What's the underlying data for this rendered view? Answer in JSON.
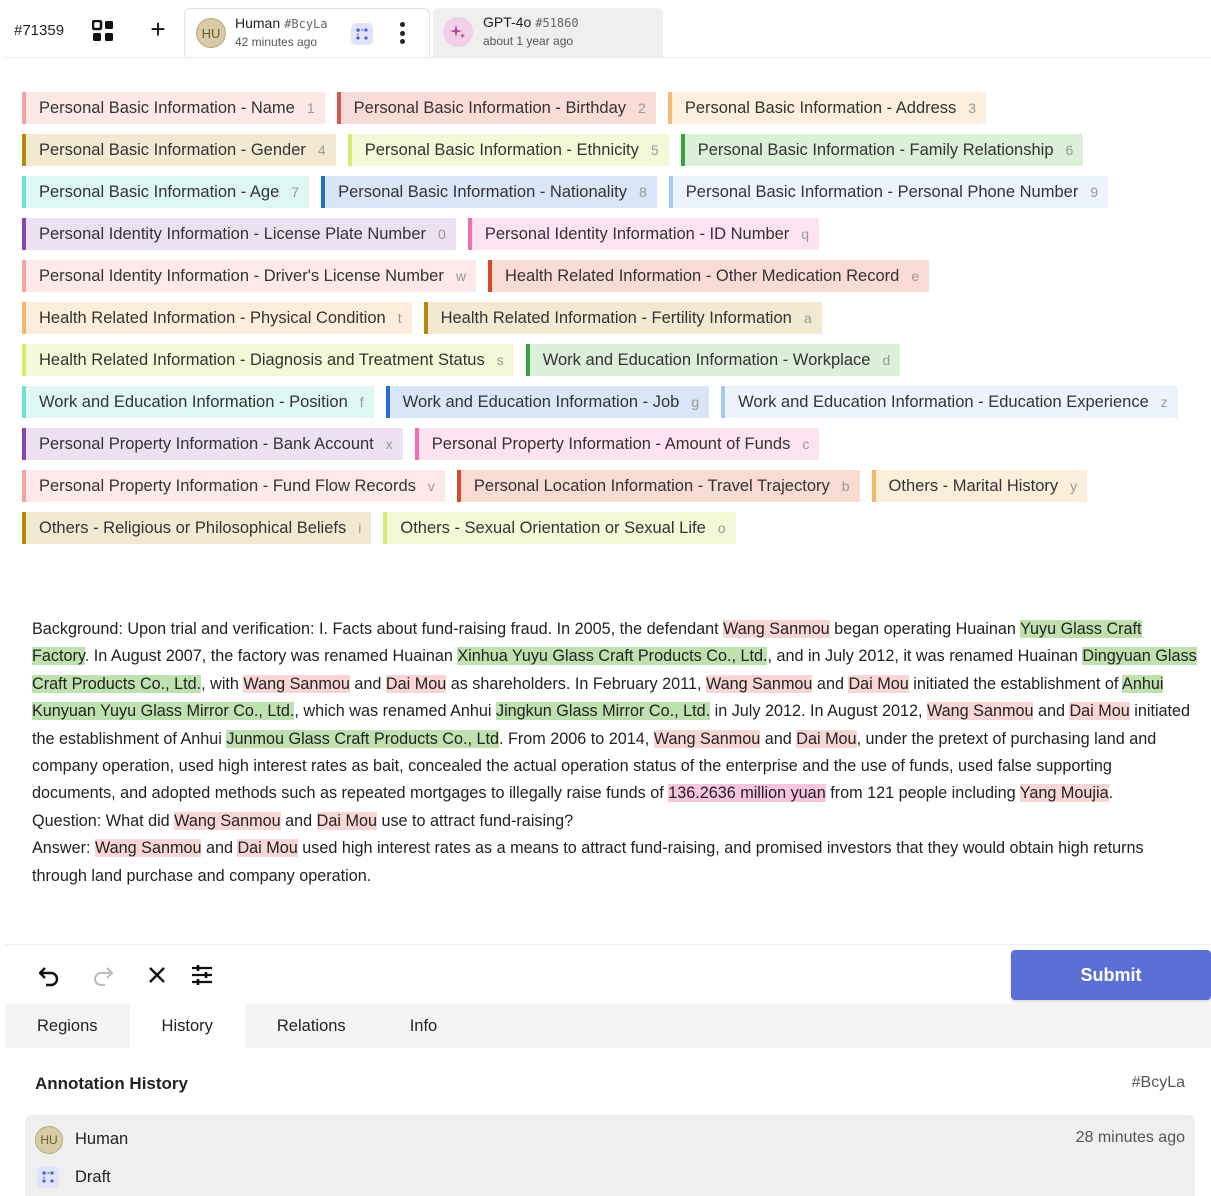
{
  "topbar": {
    "task_id": "#71359",
    "annotation_tab": {
      "user": "Human",
      "avatar": "HU",
      "id": "#BcyLa",
      "time": "42 minutes ago"
    },
    "prediction_tab": {
      "user": "GPT-4o",
      "id": "#51860",
      "time": "about 1 year ago"
    }
  },
  "labels": [
    {
      "text": "Personal Basic Information - Name",
      "hotkey": "1",
      "color": "#f3a3a3",
      "bg": "#fde8e8"
    },
    {
      "text": "Personal Basic Information - Birthday",
      "hotkey": "2",
      "color": "#d9534f",
      "bg": "#f9dcd8"
    },
    {
      "text": "Personal Basic Information - Address",
      "hotkey": "3",
      "color": "#f5b97a",
      "bg": "#fdeedd"
    },
    {
      "text": "Personal Basic Information - Gender",
      "hotkey": "4",
      "color": "#b8860b",
      "bg": "#f3e9d2"
    },
    {
      "text": "Personal Basic Information - Ethnicity",
      "hotkey": "5",
      "color": "#d4ed6b",
      "bg": "#f3f9d8"
    },
    {
      "text": "Personal Basic Information - Family Relationship",
      "hotkey": "6",
      "color": "#3aa33a",
      "bg": "#dcefd8"
    },
    {
      "text": "Personal Basic Information - Age",
      "hotkey": "7",
      "color": "#6fe0d4",
      "bg": "#dff7f3"
    },
    {
      "text": "Personal Basic Information - Nationality",
      "hotkey": "8",
      "color": "#1f6fd1",
      "bg": "#d9e6f7"
    },
    {
      "text": "Personal Basic Information - Personal Phone Number",
      "hotkey": "9",
      "color": "#a8c8f5",
      "bg": "#edf3fc"
    },
    {
      "text": "Personal Identity Information - License Plate Number",
      "hotkey": "0",
      "color": "#8e44ad",
      "bg": "#ece1f2"
    },
    {
      "text": "Personal Identity Information - ID Number",
      "hotkey": "q",
      "color": "#f06fb0",
      "bg": "#fde2ef"
    },
    {
      "text": "Personal Identity Information - Driver's License Number",
      "hotkey": "w",
      "color": "#f5a3a3",
      "bg": "#fde9e9"
    },
    {
      "text": "Health Related Information - Other Medication Record",
      "hotkey": "e",
      "color": "#d44a2a",
      "bg": "#f8dbd3"
    },
    {
      "text": "Health Related Information - Physical Condition",
      "hotkey": "t",
      "color": "#f5b66b",
      "bg": "#fdeedc"
    },
    {
      "text": "Health Related Information - Fertility Information",
      "hotkey": "a",
      "color": "#b8860b",
      "bg": "#f3e9d2"
    },
    {
      "text": "Health Related Information - Diagnosis and Treatment Status",
      "hotkey": "s",
      "color": "#d4ed6b",
      "bg": "#f3f9d8"
    },
    {
      "text": "Work and Education Information - Workplace",
      "hotkey": "d",
      "color": "#3aa33a",
      "bg": "#dcefd8"
    },
    {
      "text": "Work and Education Information - Position",
      "hotkey": "f",
      "color": "#6fe0d4",
      "bg": "#dff7f3"
    },
    {
      "text": "Work and Education Information - Job",
      "hotkey": "g",
      "color": "#1f6fd1",
      "bg": "#d9e6f7"
    },
    {
      "text": "Work and Education Information - Education Experience",
      "hotkey": "z",
      "color": "#a8c8f5",
      "bg": "#edf3fc"
    },
    {
      "text": "Personal Property Information - Bank Account",
      "hotkey": "x",
      "color": "#8e44ad",
      "bg": "#ece1f2"
    },
    {
      "text": "Personal Property Information - Amount of Funds",
      "hotkey": "c",
      "color": "#f06fb0",
      "bg": "#fde2ef"
    },
    {
      "text": "Personal Property Information - Fund Flow Records",
      "hotkey": "v",
      "color": "#f5a3a3",
      "bg": "#fde9e9"
    },
    {
      "text": "Personal Location Information - Travel Trajectory",
      "hotkey": "b",
      "color": "#d44a2a",
      "bg": "#f8dbd3"
    },
    {
      "text": "Others - Marital History",
      "hotkey": "y",
      "color": "#f5b66b",
      "bg": "#fdeedc"
    },
    {
      "text": "Others - Religious or Philosophical Beliefs",
      "hotkey": "i",
      "color": "#b8860b",
      "bg": "#f3e9d2"
    },
    {
      "text": "Others - Sexual Orientation or Sexual Life",
      "hotkey": "o",
      "color": "#d4ed6b",
      "bg": "#f3f9d8"
    }
  ],
  "document": {
    "paragraphs": [
      [
        {
          "t": "Background: Upon trial and verification: I. Facts about fund-raising fraud. In 2005, the defendant "
        },
        {
          "t": "Wang Sanmou",
          "h": "name"
        },
        {
          "t": " began operating Huainan "
        },
        {
          "t": "Yuyu Glass Craft Factory",
          "h": "org"
        },
        {
          "t": ". In August 2007, the factory was renamed Huainan "
        },
        {
          "t": "Xinhua Yuyu Glass Craft Products Co., Ltd.",
          "h": "org"
        },
        {
          "t": ", and in July 2012, it was renamed Huainan "
        },
        {
          "t": "Dingyuan Glass Craft Products Co., Ltd.",
          "h": "org"
        },
        {
          "t": ", with "
        },
        {
          "t": "Wang Sanmou",
          "h": "name"
        },
        {
          "t": " and "
        },
        {
          "t": "Dai Mou",
          "h": "name"
        },
        {
          "t": " as shareholders. In February 2011, "
        },
        {
          "t": "Wang Sanmou",
          "h": "name"
        },
        {
          "t": " and "
        },
        {
          "t": "Dai Mou",
          "h": "name"
        },
        {
          "t": " initiated the establishment of "
        },
        {
          "t": "Anhui Kunyuan Yuyu Glass Mirror Co., Ltd.",
          "h": "org"
        },
        {
          "t": ", which was renamed Anhui "
        },
        {
          "t": "Jingkun Glass Mirror Co., Ltd.",
          "h": "org"
        },
        {
          "t": " in July 2012. In August 2012, "
        },
        {
          "t": "Wang Sanmou",
          "h": "name"
        },
        {
          "t": " and "
        },
        {
          "t": "Dai Mou",
          "h": "name"
        },
        {
          "t": " initiated the establishment of Anhui "
        },
        {
          "t": "Junmou Glass Craft Products Co., Ltd",
          "h": "org"
        },
        {
          "t": ". From 2006 to 2014, "
        },
        {
          "t": "Wang Sanmou",
          "h": "name"
        },
        {
          "t": " and "
        },
        {
          "t": "Dai Mou",
          "h": "name"
        },
        {
          "t": ", under the pretext of purchasing land and company operation, used high interest rates as bait, concealed the actual operation status of the enterprise and the use of funds, used false supporting documents, and adopted methods such as repeated mortgages to illegally raise funds of "
        },
        {
          "t": "136.2636 million yuan",
          "h": "money"
        },
        {
          "t": " from 121 people including "
        },
        {
          "t": "Yang Moujia",
          "h": "name"
        },
        {
          "t": "."
        }
      ],
      [
        {
          "t": "Question: What did "
        },
        {
          "t": "Wang Sanmou",
          "h": "name"
        },
        {
          "t": " and "
        },
        {
          "t": "Dai Mou",
          "h": "name"
        },
        {
          "t": " use to attract fund-raising?"
        }
      ],
      [
        {
          "t": "Answer: "
        },
        {
          "t": "Wang Sanmou",
          "h": "name"
        },
        {
          "t": " and "
        },
        {
          "t": "Dai Mou",
          "h": "name"
        },
        {
          "t": " used high interest rates as a means to attract fund-raising, and promised investors that they would obtain high returns through land purchase and company operation."
        }
      ]
    ]
  },
  "toolbar": {
    "submit_label": "Submit"
  },
  "bottom_tabs": [
    "Regions",
    "History",
    "Relations",
    "Info"
  ],
  "history": {
    "title": "Annotation History",
    "id": "#BcyLa",
    "entries": [
      {
        "avatar": "HU",
        "user": "Human",
        "time": "28 minutes ago"
      },
      {
        "user": "Draft"
      }
    ]
  }
}
